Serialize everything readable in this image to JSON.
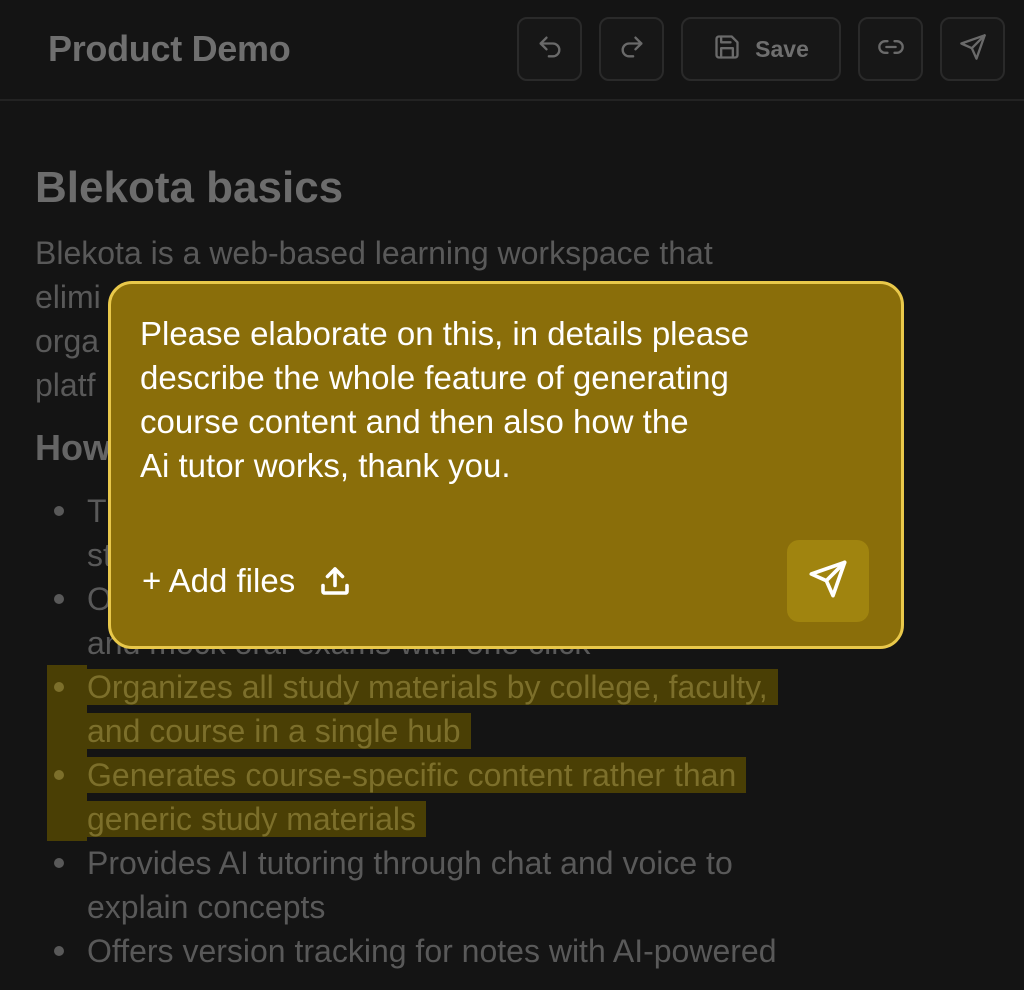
{
  "header": {
    "title": "Product Demo",
    "save_label": "Save",
    "icons": [
      "undo-icon",
      "redo-icon",
      "save-icon",
      "link-icon",
      "send-icon"
    ]
  },
  "document": {
    "heading": "Blekota basics",
    "paragraph_visible_lines": [
      "Blekota is a web-based learning workspace that",
      "elimi",
      "orga",
      "platf"
    ],
    "subheading_partial": "How",
    "list_items": [
      {
        "line1": "T",
        "line2": "st",
        "highlighted": false
      },
      {
        "line1": "O",
        "line2": "and mock oral exams with one click",
        "highlighted": false
      },
      {
        "line1": "Organizes all study materials by college, faculty,",
        "line2": "and course in a single hub",
        "highlighted": true
      },
      {
        "line1": "Generates course-specific content rather than",
        "line2": "generic study materials",
        "highlighted": true
      },
      {
        "line1": "Provides AI tutoring through chat and voice to",
        "line2": "explain concepts",
        "highlighted": false
      },
      {
        "line1": "Offers version tracking for notes with AI-powered",
        "line2": "",
        "highlighted": false
      }
    ]
  },
  "popup": {
    "prompt_text": "Please elaborate on this, in details please\ndescribe the whole feature of generating\ncourse content and then also how the\nAi tutor works, thank you.",
    "add_files_label": "+ Add files"
  },
  "colors": {
    "background": "#141414",
    "popup_fill": "#8a6e0a",
    "popup_border": "#e9c84a",
    "highlight": "#4a3f05"
  }
}
